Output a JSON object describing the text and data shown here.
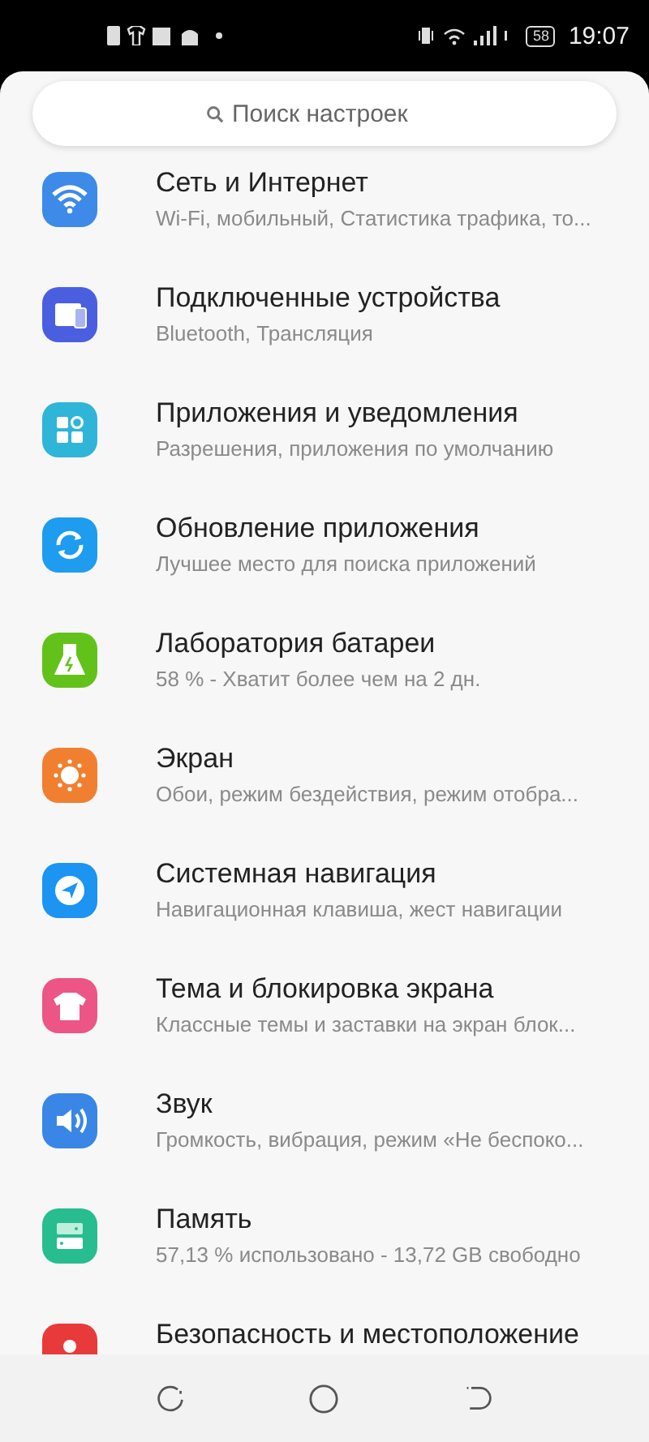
{
  "status_bar": {
    "battery": "58",
    "time": "19:07"
  },
  "search": {
    "placeholder": "Поиск настроек"
  },
  "settings": [
    {
      "kind": "wifi",
      "color": "#3d8ae8",
      "title": "Сеть и Интернет",
      "subtitle": "Wi-Fi, мобильный, Статистика трафика, то..."
    },
    {
      "kind": "devices",
      "color": "#4a5fe0",
      "title": "Подключенные устройства",
      "subtitle": "Bluetooth, Трансляция"
    },
    {
      "kind": "apps",
      "color": "#2fb5d8",
      "title": "Приложения и уведомления",
      "subtitle": "Разрешения, приложения по умолчанию"
    },
    {
      "kind": "update",
      "color": "#1e9cef",
      "title": "Обновление приложения",
      "subtitle": "Лучшее место для поиска приложений"
    },
    {
      "kind": "battery",
      "color": "#62c21a",
      "title": "Лаборатория батареи",
      "subtitle": "58 % - Хватит более чем на 2 дн."
    },
    {
      "kind": "display",
      "color": "#f08030",
      "title": "Экран",
      "subtitle": "Обои, режим бездействия, режим отобра..."
    },
    {
      "kind": "navigation",
      "color": "#1b94f2",
      "title": "Системная навигация",
      "subtitle": "Навигационная клавиша, жест навигации"
    },
    {
      "kind": "theme",
      "color": "#ec5585",
      "title": "Тема и блокировка экрана",
      "subtitle": "Классные темы и заставки на экран блок..."
    },
    {
      "kind": "sound",
      "color": "#3a86e6",
      "title": "Звук",
      "subtitle": "Громкость, вибрация, режим «Не беспоко..."
    },
    {
      "kind": "storage",
      "color": "#27bd8e",
      "title": "Память",
      "subtitle": "57,13 % использовано - 13,72 GB свободно"
    },
    {
      "kind": "security",
      "color": "#e83a3a",
      "title": "Безопасность и местоположение"
    }
  ]
}
